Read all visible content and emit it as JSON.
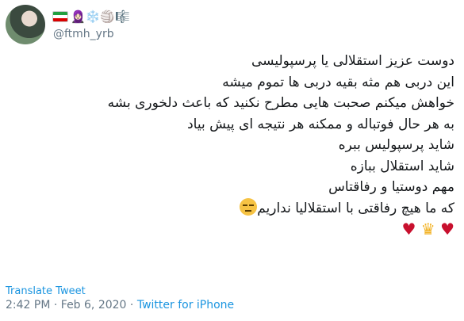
{
  "user": {
    "handle": "@ftmh_yrb",
    "name_emoji": "🧕🏻❄️🏐🎼"
  },
  "tweet": {
    "lines": [
      "دوست عزیز استقلالی یا پرسپولیسی",
      "این دربی هم مثه بقیه دربی ها تموم میشه",
      "خواهش میکنم صحبت هایی مطرح نکنید که باعث دلخوری بشه",
      "به هر حال فوتباله و ممکنه هر نتیجه ای پیش بیاد",
      "شاید پرسپولیس ببره",
      "شاید استقلال ببازه",
      "مهم دوستیا و رفاقتاس",
      "که ما هیچ رفاقتی با استقلالیا نداریم"
    ],
    "end_emoji": [
      "heart",
      "crown",
      "heart"
    ]
  },
  "colors": {
    "link": "#1b95e0",
    "muted": "#657786",
    "heart": "#c8102e"
  },
  "actions": {
    "translate": "Translate Tweet"
  },
  "meta": {
    "time": "2:42 PM",
    "date": "Feb 6, 2020",
    "source": "Twitter for iPhone"
  }
}
